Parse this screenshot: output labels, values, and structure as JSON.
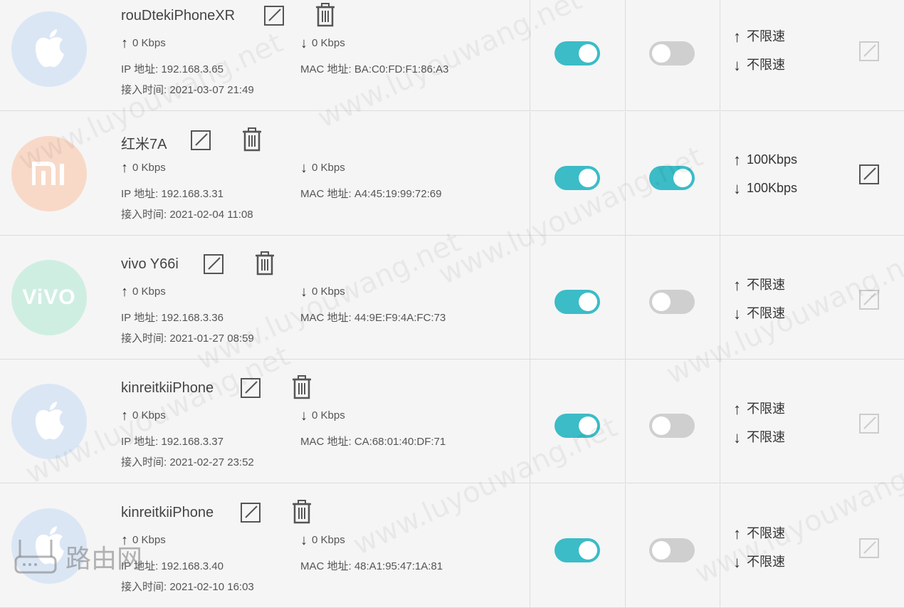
{
  "devices": [
    {
      "name": "rouDtekiPhoneXR",
      "avatar": {
        "kind": "apple",
        "color": "#dbe6f5"
      },
      "up": "0 Kbps",
      "down": "0 Kbps",
      "ip": "IP 地址: 192.168.3.65",
      "mac": "MAC 地址: BA:C0:FD:F1:86:A3",
      "time": "接入时间: 2021-03-07 21:49",
      "toggle1": true,
      "toggle2": false,
      "limit_up": "不限速",
      "limit_down": "不限速",
      "limit_edit_active": false
    },
    {
      "name": "红米7A",
      "avatar": {
        "kind": "mi",
        "color": "#f8d9c8"
      },
      "up": "0 Kbps",
      "down": "0 Kbps",
      "ip": "IP 地址: 192.168.3.31",
      "mac": "MAC 地址: A4:45:19:99:72:69",
      "time": "接入时间: 2021-02-04 11:08",
      "toggle1": true,
      "toggle2": true,
      "limit_up": "100Kbps",
      "limit_down": "100Kbps",
      "limit_edit_active": true
    },
    {
      "name": "vivo Y66i",
      "avatar": {
        "kind": "vivo",
        "color": "#cfeee2",
        "text": "ViVO"
      },
      "up": "0 Kbps",
      "down": "0 Kbps",
      "ip": "IP 地址: 192.168.3.36",
      "mac": "MAC 地址: 44:9E:F9:4A:FC:73",
      "time": "接入时间: 2021-01-27 08:59",
      "toggle1": true,
      "toggle2": false,
      "limit_up": "不限速",
      "limit_down": "不限速",
      "limit_edit_active": false
    },
    {
      "name": "kinreitkiiPhone",
      "avatar": {
        "kind": "apple",
        "color": "#dbe6f5"
      },
      "up": "0 Kbps",
      "down": "0 Kbps",
      "ip": "IP 地址: 192.168.3.37",
      "mac": "MAC 地址: CA:68:01:40:DF:71",
      "time": "接入时间: 2021-02-27 23:52",
      "toggle1": true,
      "toggle2": false,
      "limit_up": "不限速",
      "limit_down": "不限速",
      "limit_edit_active": false
    },
    {
      "name": "kinreitkiiPhone",
      "avatar": {
        "kind": "apple",
        "color": "#dbe6f5"
      },
      "up": "0 Kbps",
      "down": "0 Kbps",
      "ip": "IP 地址: 192.168.3.40",
      "mac": "MAC 地址: 48:A1:95:47:1A:81",
      "time": "接入时间: 2021-02-10 16:03",
      "toggle1": true,
      "toggle2": false,
      "limit_up": "不限速",
      "limit_down": "不限速",
      "limit_edit_active": false
    }
  ],
  "arrows": {
    "up": "↑",
    "down": "↓"
  },
  "icons": {
    "edit": "edit-icon",
    "delete": "trash-icon",
    "apple": "apple-logo",
    "mi": "mi-logo"
  },
  "colors": {
    "toggle_on": "#3bbcc7",
    "toggle_off": "#cfcfcf"
  },
  "watermark": {
    "site": "www.luyouwang.net",
    "brand": "路由网"
  }
}
